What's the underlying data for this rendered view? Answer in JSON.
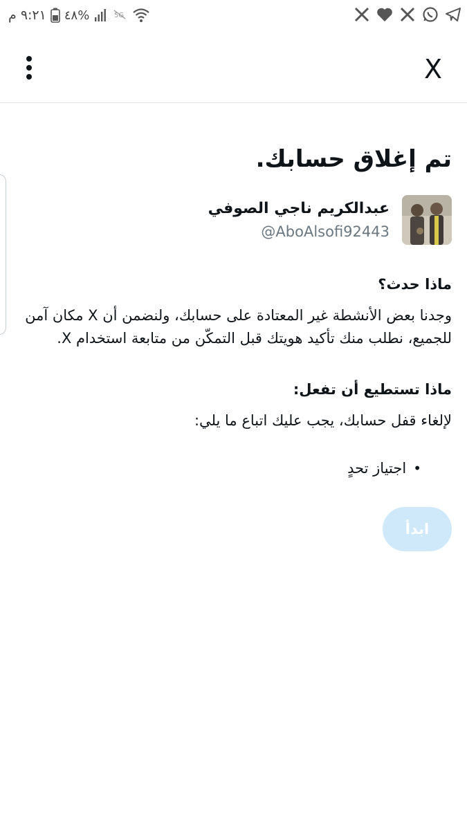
{
  "status_bar": {
    "time": "٩:٢١ م",
    "battery": "٤٨%",
    "icons_left": [
      "battery-icon",
      "signal-icon",
      "wifi-off-icon",
      "wifi-icon"
    ],
    "icons_right": [
      "x-logo-icon",
      "heart-icon",
      "x-logo-icon",
      "whatsapp-icon",
      "telegram-icon"
    ]
  },
  "app_bar": {
    "more_icon": "more-vertical-icon",
    "close_label": "X"
  },
  "content": {
    "title": "تم إغلاق حسابك.",
    "profile": {
      "name": "عبدالكريم ناجي الصوفي",
      "handle": "@AboAlsofi92443"
    },
    "what_happened_heading": "ماذا حدث؟",
    "what_happened_body": "وجدنا بعض الأنشطة غير المعتادة على حسابك، ولنضمن أن X مكان آمن للجميع، نطلب منك تأكيد هويتك قبل التمكّن من متابعة استخدام X.",
    "what_you_can_do_heading": "ماذا تستطيع أن تفعل:",
    "what_you_can_do_body": "لإلغاء قفل حسابك، يجب عليك اتباع ما يلي:",
    "steps": [
      "اجتياز تحدٍ"
    ],
    "start_button_label": "ابدأ"
  },
  "colors": {
    "accent_disabled": "#cfe9fb",
    "text_primary": "#0f1419",
    "text_secondary": "#6b7780"
  }
}
